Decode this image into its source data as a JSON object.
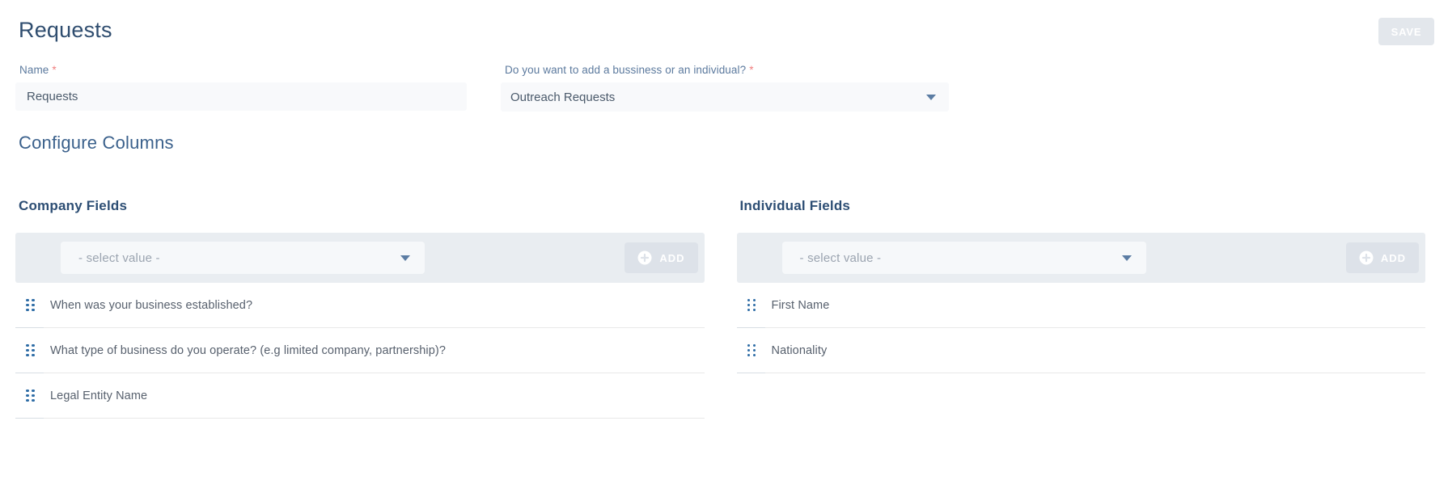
{
  "page": {
    "title": "Requests"
  },
  "header": {
    "save_label": "SAVE"
  },
  "form": {
    "name_field": {
      "label": "Name",
      "required_mark": "*",
      "value": "Requests"
    },
    "type_field": {
      "label": "Do you want to add a bussiness or an individual?",
      "required_mark": "*",
      "value": "Outreach Requests"
    }
  },
  "configure": {
    "title": "Configure Columns",
    "columns": [
      {
        "title": "Company Fields",
        "select_placeholder": "- select value -",
        "add_label": "ADD",
        "items": [
          "When was your business established?",
          "What type of business do you operate? (e.g limited company, partnership)?",
          "Legal Entity Name"
        ]
      },
      {
        "title": "Individual Fields",
        "select_placeholder": "- select value -",
        "add_label": "ADD",
        "items": [
          "First Name",
          "Nationality"
        ]
      }
    ]
  },
  "icons": {
    "chevron_down": "caret-down-icon",
    "add_plus": "plus-circle-icon",
    "drag": "drag-handle-icon"
  },
  "colors": {
    "heading_dark_blue": "#2f4d6f",
    "section_blue": "#3b618c",
    "column_title_blue": "#2d4e74",
    "label_blue": "#5c7a9e",
    "required_red": "#f07e7e",
    "input_bg": "#f8f9fb",
    "bar_bg": "#e9edf1",
    "select_bg": "#f6f8fa",
    "button_bg": "#dde2e9",
    "save_bg": "#e3e7ec",
    "handle_blue": "#2d6ca5",
    "caret_blue": "#5b7ca3",
    "row_text": "#57606d",
    "divider": "#e9e9e9"
  }
}
